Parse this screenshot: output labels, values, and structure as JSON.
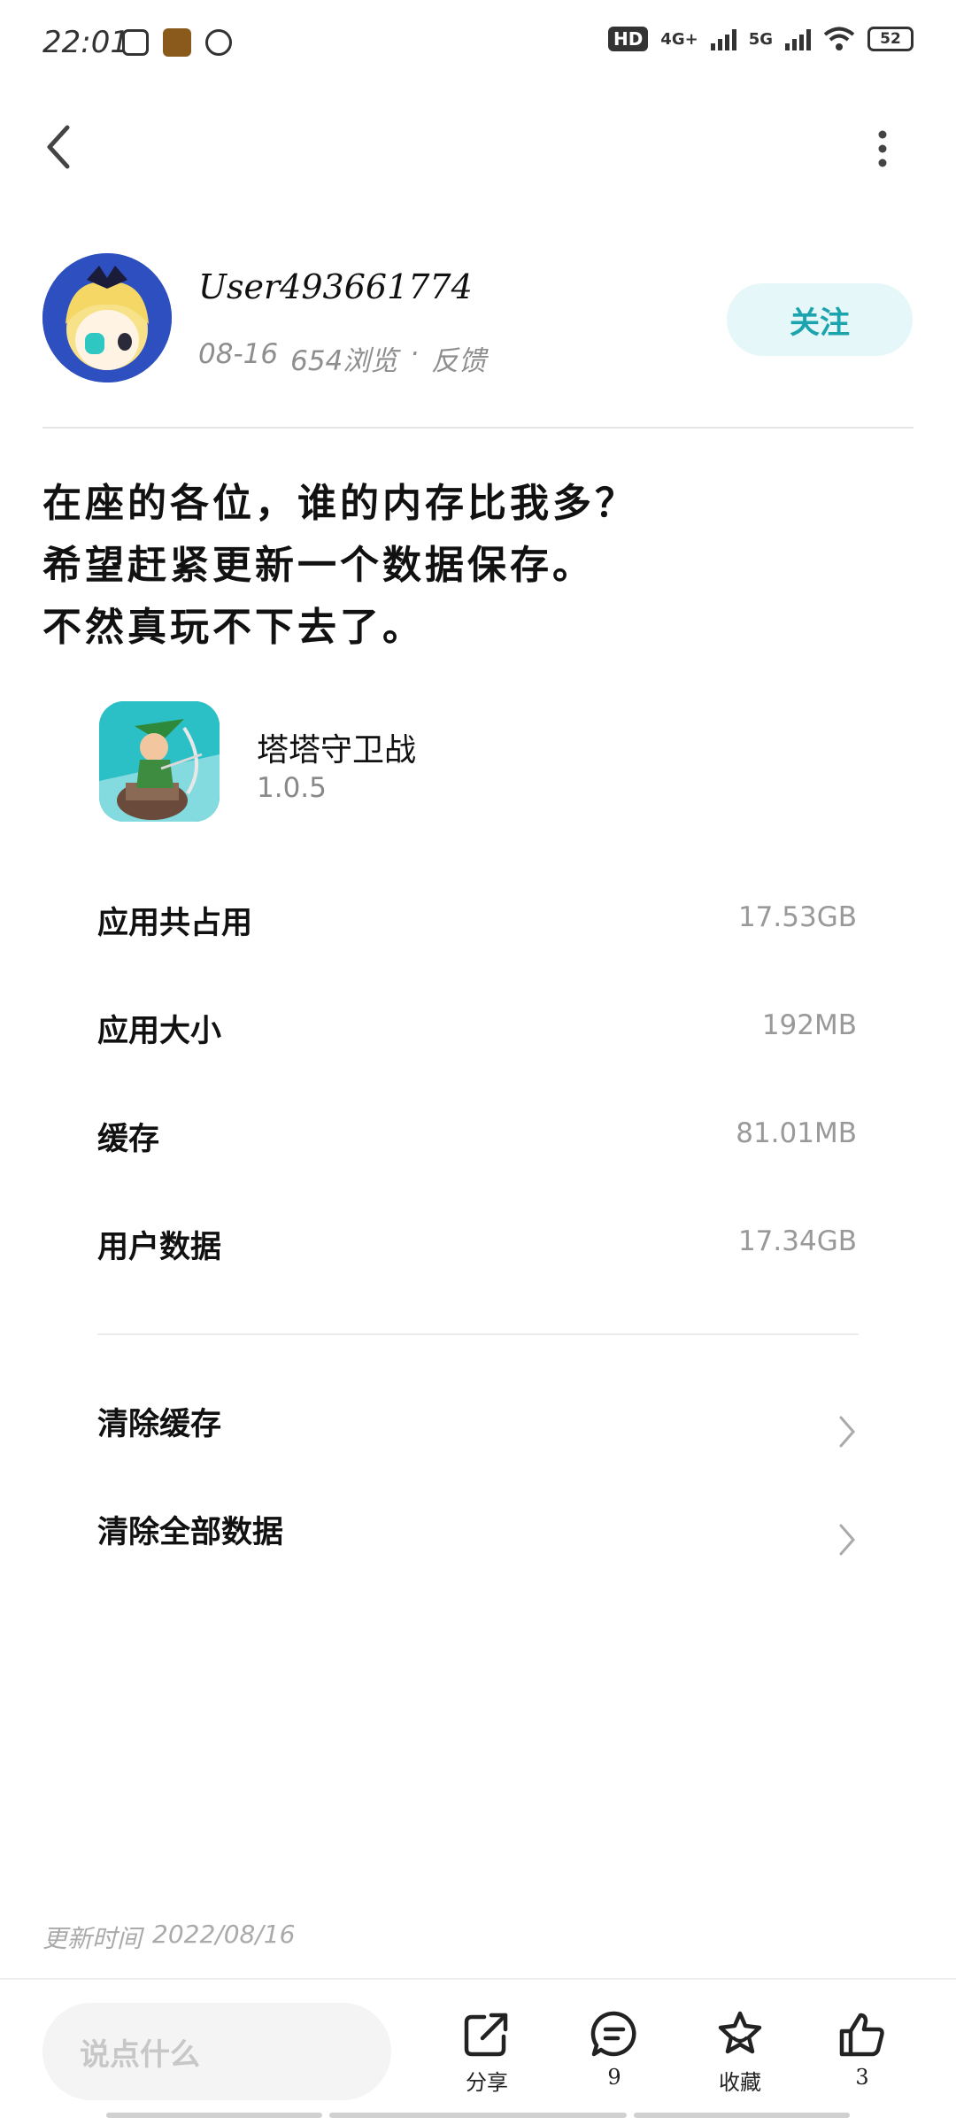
{
  "status_bar": {
    "time": "22:01",
    "battery": "52",
    "hd": "HD",
    "net1": "4G+",
    "net2": "5G"
  },
  "author": {
    "username": "User493661774",
    "date": "08-16",
    "views": "654浏览",
    "dot": "·",
    "feedback": "反馈",
    "follow_label": "关注"
  },
  "post": {
    "lines": [
      "在座的各位，谁的内存比我多？",
      "希望赶紧更新一个数据保存。",
      "不然真玩不下去了。"
    ]
  },
  "app": {
    "name": "塔塔守卫战",
    "version": "1.0.5"
  },
  "storage_rows": [
    {
      "label": "应用共占用",
      "value": "17.53GB"
    },
    {
      "label": "应用大小",
      "value": "192MB"
    },
    {
      "label": "缓存",
      "value": "81.01MB"
    },
    {
      "label": "用户数据",
      "value": "17.34GB"
    }
  ],
  "actions_list": [
    {
      "label": "清除缓存"
    },
    {
      "label": "清除全部数据"
    }
  ],
  "footer": {
    "update_label": "更新时间",
    "update_date": "2022/08/16",
    "comment_placeholder": "说点什么",
    "share_label": "分享",
    "comment_count": "9",
    "favorite_label": "收藏",
    "like_count": "3"
  },
  "colors": {
    "accent": "#1ba4ad",
    "follow_bg": "#e5f7f8"
  }
}
